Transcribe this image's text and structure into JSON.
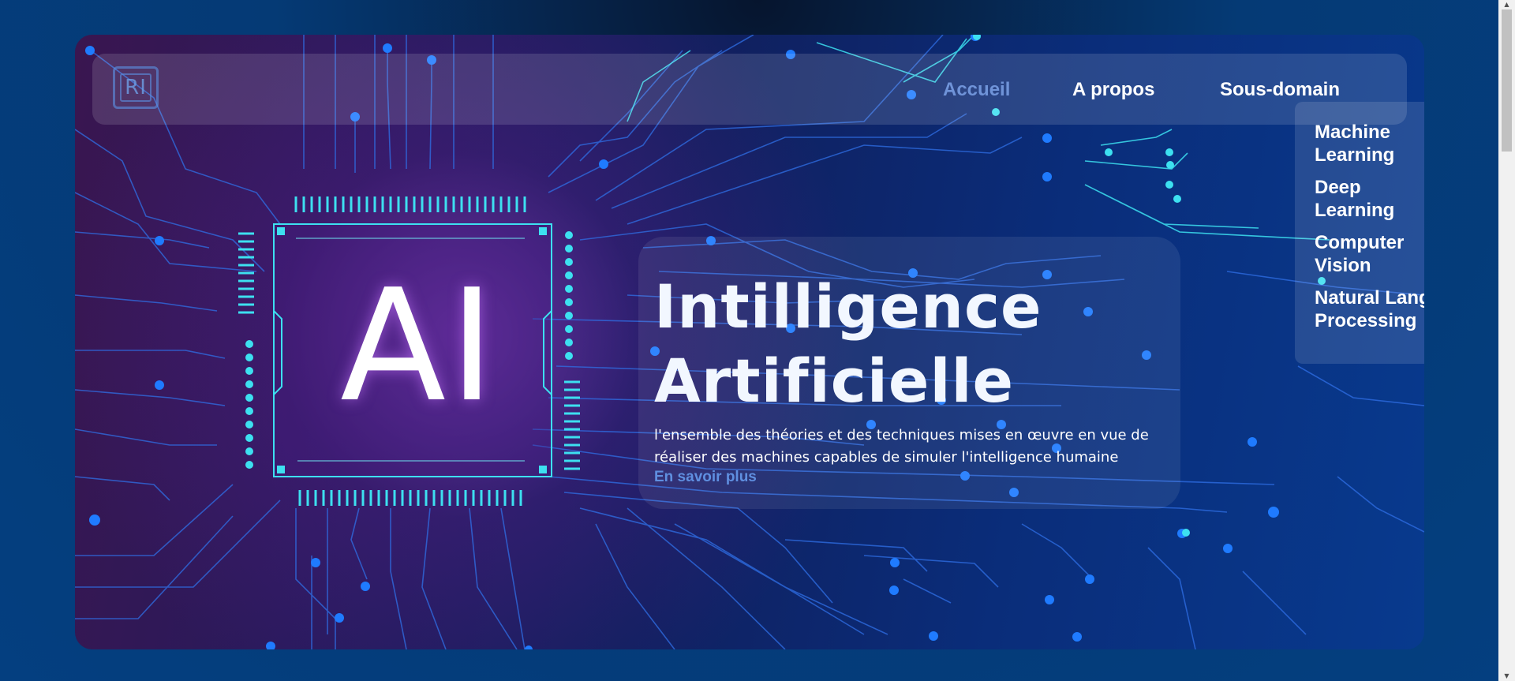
{
  "logo": {
    "text": "RI"
  },
  "nav": {
    "items": [
      {
        "label": "Accueil",
        "active": true
      },
      {
        "label": "A propos",
        "active": false
      },
      {
        "label": "Sous-domain",
        "active": false
      }
    ]
  },
  "dropdown": {
    "items": [
      {
        "line1": "Machine",
        "line2": "Learning"
      },
      {
        "line1": "Deep",
        "line2": "Learning"
      },
      {
        "line1": "Computer",
        "line2": "Vision"
      },
      {
        "line1": "Natural Language",
        "line2": "Processing"
      }
    ]
  },
  "hero": {
    "chip_text": "AI",
    "title_line1": "Intilligence",
    "title_line2": "Artificielle",
    "description_line1": "l'ensemble des théories et des techniques mises en œuvre en vue de",
    "description_line2": "réaliser des machines capables de simuler l'intelligence humaine",
    "learn_more": "En savoir plus"
  },
  "scrollbar": {
    "up_icon": "triangle-up-icon",
    "down_icon": "triangle-down-icon"
  },
  "colors": {
    "accent_link": "#5f8fe0",
    "active_nav": "#6f93d8",
    "circuit_cyan": "#3de0f0",
    "circuit_blue": "#1f6fff"
  }
}
